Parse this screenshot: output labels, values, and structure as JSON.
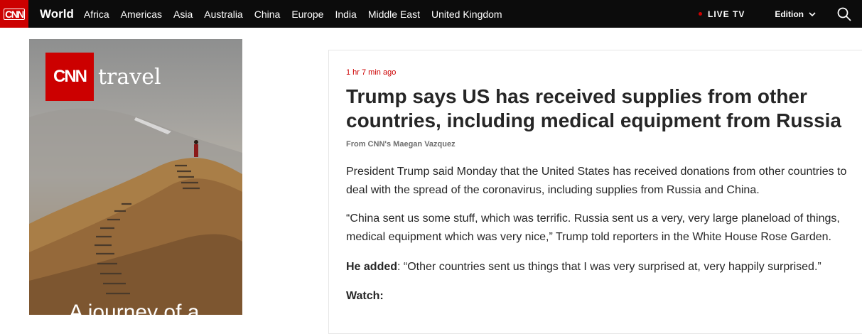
{
  "nav": {
    "logo": "CNN",
    "section_title": "World",
    "links": [
      "Africa",
      "Americas",
      "Asia",
      "Australia",
      "China",
      "Europe",
      "India",
      "Middle East",
      "United Kingdom"
    ],
    "live_label": "LIVE TV",
    "edition_label": "Edition",
    "icons": {
      "live": "live-dot-icon",
      "edition": "chevron-down-icon",
      "search": "search-icon"
    },
    "colors": {
      "brand": "#cc0000",
      "nav_bg": "#0c0c0c"
    }
  },
  "ad": {
    "brand": "CNN",
    "brand_suffix": "travel",
    "tagline": "A journey of a"
  },
  "article": {
    "timestamp": "1 hr 7 min ago",
    "headline": "Trump says US has received supplies from other countries, including medical equipment from Russia",
    "byline": "From CNN's Maegan Vazquez",
    "p1_line1": "President Trump said Monday that the United States has received donations from other countries to",
    "p1_line2": "deal with the spread of the coronavirus, including supplies from Russia and China.",
    "p2_line1": "“China sent us some stuff, which was terrific. Russia sent us a very, very large planeload of things,",
    "p2_line2": "medical equipment which was very nice,” Trump told reporters in the White House Rose Garden.",
    "p3_bold": "He added",
    "p3_rest": ": “Other countries sent us things that I was very surprised at, very happily surprised.”",
    "watch_label": "Watch:"
  }
}
